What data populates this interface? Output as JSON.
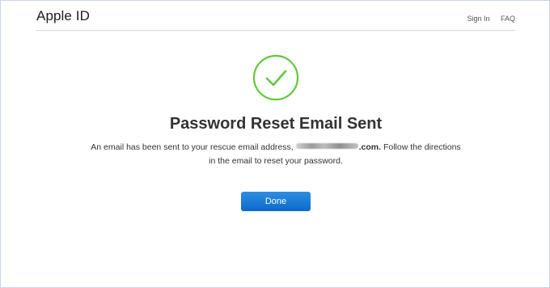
{
  "header": {
    "brand": "Apple ID",
    "nav": {
      "sign_in": "Sign In",
      "faq": "FAQ"
    }
  },
  "main": {
    "icon": "checkmark-circle-icon",
    "title": "Password Reset Email Sent",
    "message_before": "An email has been sent to your rescue email address, ",
    "email_domain": ".com.",
    "message_after": " Follow the directions in the email to reset your password.",
    "done_label": "Done"
  },
  "colors": {
    "success_green": "#62c93a",
    "button_blue": "#1a7ad9",
    "border": "#c9d6ea"
  }
}
